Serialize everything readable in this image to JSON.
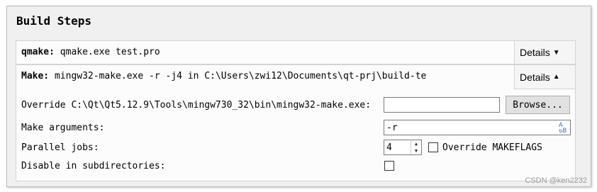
{
  "panel": {
    "title": "Build Steps"
  },
  "steps": [
    {
      "name": "qmake:",
      "command": "qmake.exe test.pro",
      "details_label": "Details",
      "details_arrow": "▼"
    },
    {
      "name": "Make:",
      "command": "mingw32-make.exe -r -j4 in C:\\Users\\zwi12\\Documents\\qt-prj\\build-te",
      "details_label": "Details",
      "details_arrow": "▲"
    }
  ],
  "make_config": {
    "override_label": "Override C:\\Qt\\Qt5.12.9\\Tools\\mingw730_32\\bin\\mingw32-make.exe:",
    "override_value": "",
    "browse_label": "Browse...",
    "args_label": "Make arguments:",
    "args_value": "-r",
    "args_icon": "text-direction-icon",
    "jobs_label": "Parallel jobs:",
    "jobs_value": "4",
    "override_makeflags_label": "Override MAKEFLAGS",
    "override_makeflags_checked": false,
    "disable_subdirs_label": "Disable in subdirectories:",
    "disable_subdirs_checked": false
  },
  "watermark": "CSDN @ken2232"
}
